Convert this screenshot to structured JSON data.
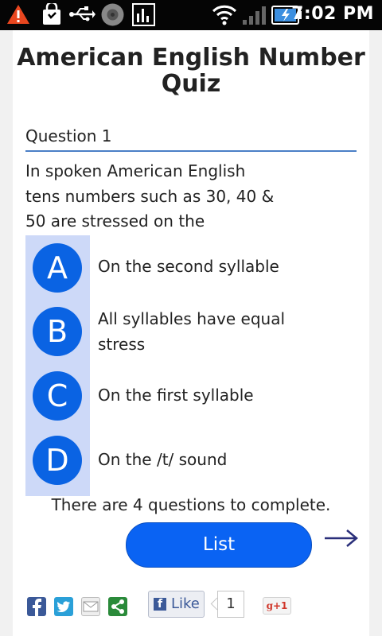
{
  "status_bar": {
    "time": "7:02 PM",
    "icons": [
      "warning-icon",
      "shopping-bag-icon",
      "usb-icon",
      "media-icon",
      "chart-icon",
      "wifi-icon",
      "signal-icon",
      "battery-charging-icon"
    ]
  },
  "quiz": {
    "title": "American English Number Quiz",
    "question_label": "Question 1",
    "question_text": "In spoken American English  tens numbers such as 30, 40 & 50 are stressed on the"
  },
  "answers": [
    {
      "letter": "A",
      "text": "On the second syllable"
    },
    {
      "letter": "B",
      "text": "All syllables have equal stress"
    },
    {
      "letter": "C",
      "text": "On the first syllable"
    },
    {
      "letter": "D",
      "text": "On the /t/ sound"
    }
  ],
  "progress_text": "There are 4 questions to complete.",
  "list_button": "List",
  "next_icon": "arrow-right-icon",
  "share": {
    "icons": [
      "facebook-icon",
      "twitter-icon",
      "email-icon",
      "share-icon"
    ],
    "like_label": "Like",
    "like_count": "1",
    "gplus_label": "+1"
  },
  "colors": {
    "accent": "#0a63e3",
    "answer_panel": "#cdd9f8",
    "rule": "#4a7fc6"
  }
}
